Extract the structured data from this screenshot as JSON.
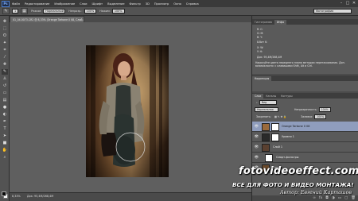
{
  "app": {
    "logo": "Ps"
  },
  "menu": [
    "Файл",
    "Редактирование",
    "Изображение",
    "Слои",
    "Шрифт",
    "Выделение",
    "Фильтр",
    "3D",
    "Просмотр",
    "Окно",
    "Справка"
  ],
  "window_controls": [
    "–",
    "□",
    "✕"
  ],
  "options": {
    "size_value": "1",
    "mode_label": "Режим:",
    "mode_value": "Нормальный",
    "opacity_label": "Непрозр.:",
    "opacity_value": "100%",
    "pressure_label": "Нажим:",
    "pressure_value": "100%",
    "preset": "Фотография"
  },
  "document": {
    "tab_title": "01_04.0073.CR2 @ 8,33% (Orange Tarkone 0 08, Слой-маска/8) *",
    "zoom": "8,33%",
    "doc_info": "Док: 95,4M/268,4M"
  },
  "top_panel": {
    "tabs": [
      "Гистограмма",
      "Инфо"
    ],
    "active_tab": 1,
    "info_rows": [
      "R:   C:",
      "G:   M:",
      "B:   Y:",
      "8-бит   K:",
      "X:   W:",
      "Y:   H:",
      "Док: 95,4M/268,4M"
    ],
    "info_note": "Нарисуйте цвета переднего плана методом перетаскивания. Доп. возможности: с клавишами Shift, Alt и Ctrl."
  },
  "correction_panel": {
    "tabs": [
      "Коррекция"
    ]
  },
  "layers_panel": {
    "tabs": [
      "Слои",
      "Каналы",
      "Контуры"
    ],
    "kind_label": "Вид",
    "blend_mode": "Нормальная",
    "opacity_label": "Непрозрачность:",
    "opacity_value": "100%",
    "lock_label": "Закрепить:",
    "fill_label": "Заливка:",
    "fill_value": "100%",
    "layers": [
      {
        "name": "Orange Tarkone 0 08",
        "selected": true
      },
      {
        "name": "Уровни 1",
        "selected": false
      },
      {
        "name": "Слой 1",
        "selected": false
      },
      {
        "name": "Смарт-фильтры",
        "selected": false
      },
      {
        "name": "Фон",
        "selected": false
      }
    ]
  },
  "tools": [
    "move-tool",
    "marquee-tool",
    "lasso-tool",
    "quick-select-tool",
    "crop-tool",
    "eyedropper-tool",
    "healing-tool",
    "brush-tool",
    "clone-tool",
    "history-brush-tool",
    "eraser-tool",
    "gradient-tool",
    "blur-tool",
    "dodge-tool",
    "pen-tool",
    "type-tool",
    "path-select-tool",
    "shape-tool",
    "hand-tool",
    "zoom-tool"
  ],
  "watermark": {
    "site": "fotovideoeffect.com",
    "slogan": "ВСЕ ДЛЯ ФОТО И ВИДЕО МОНТАЖА!",
    "author": "Автор: Евгений Карташов"
  }
}
